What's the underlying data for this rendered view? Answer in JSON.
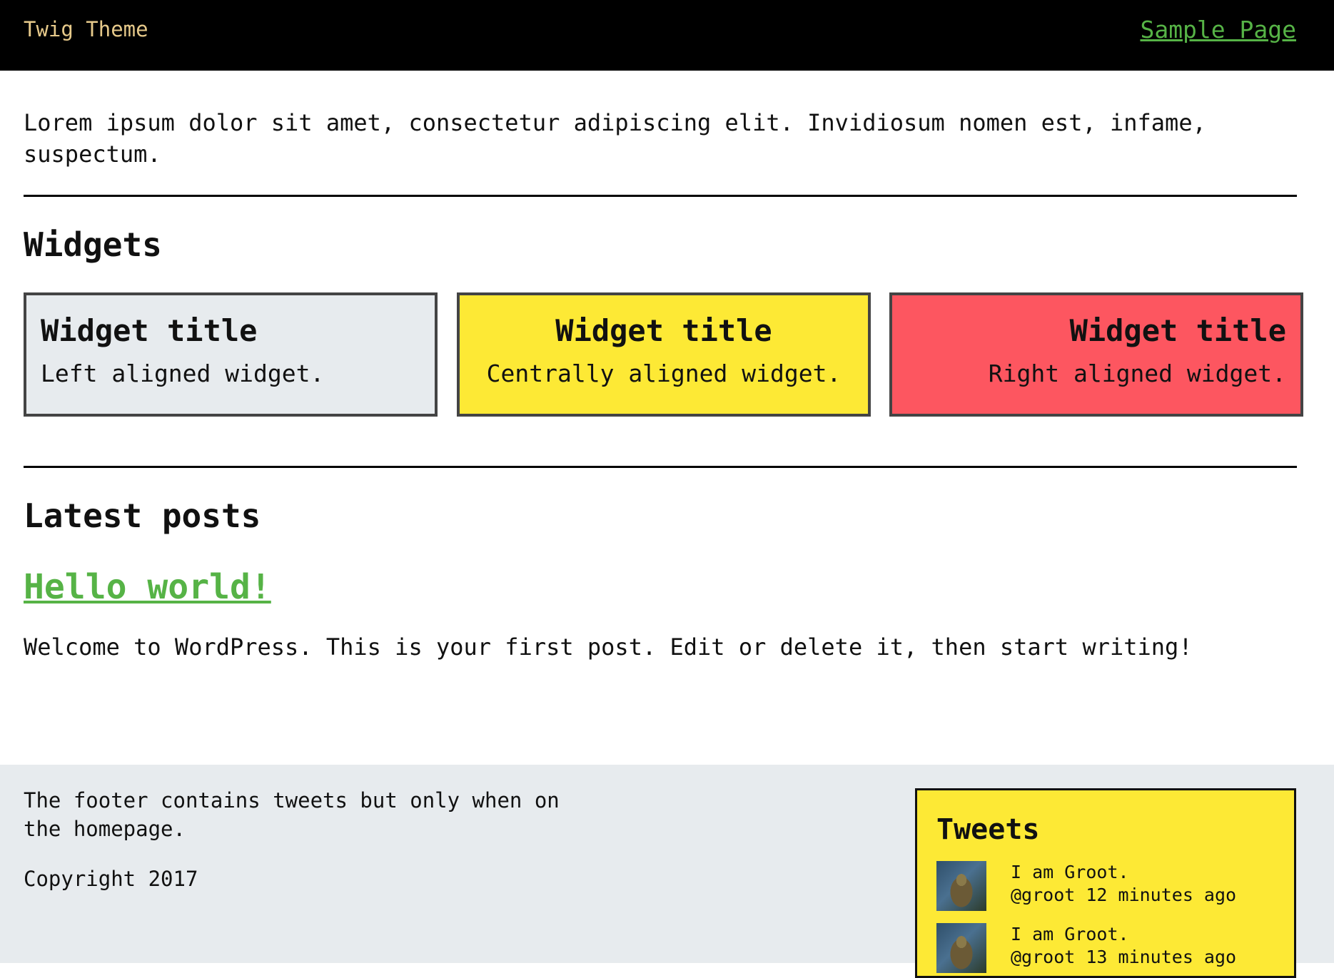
{
  "header": {
    "site_title": "Twig Theme",
    "nav": {
      "sample_page": "Sample Page"
    }
  },
  "intro": {
    "text": "Lorem ipsum dolor sit amet, consectetur adipiscing elit. Invidiosum nomen est, infame, suspectum."
  },
  "widgets_section": {
    "heading": "Widgets",
    "widgets": [
      {
        "title": "Widget title",
        "text": "Left aligned widget.",
        "color": "#e7ebee"
      },
      {
        "title": "Widget title",
        "text": "Centrally aligned widget.",
        "color": "#fde935"
      },
      {
        "title": "Widget title",
        "text": "Right aligned widget.",
        "color": "#fd5660"
      }
    ]
  },
  "posts_section": {
    "heading": "Latest posts",
    "posts": [
      {
        "title": "Hello world!",
        "excerpt": "Welcome to WordPress. This is your first post. Edit or delete it, then start writing!"
      }
    ]
  },
  "footer": {
    "text": "The footer contains tweets but only when on the homepage.",
    "copyright": "Copyright 2017",
    "tweets": {
      "title": "Tweets",
      "items": [
        {
          "text": "I am Groot.",
          "meta": "@groot 12 minutes ago"
        },
        {
          "text": "I am Groot.",
          "meta": "@groot 13 minutes ago"
        }
      ]
    }
  },
  "colors": {
    "header_bg": "#000000",
    "site_title": "#e6c98a",
    "link": "#56b346",
    "footer_bg": "#e7ebee"
  }
}
